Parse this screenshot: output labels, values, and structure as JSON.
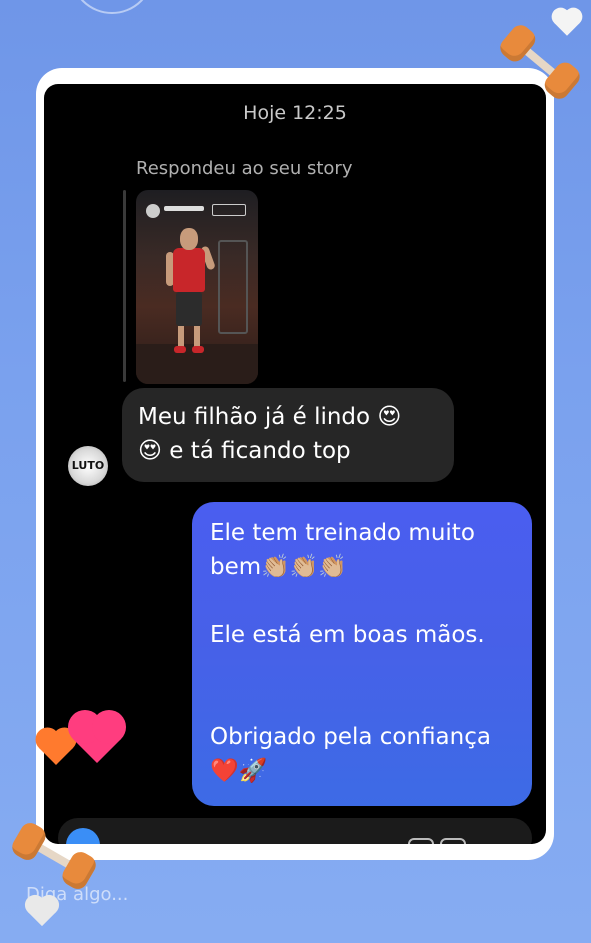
{
  "chat": {
    "timestamp": "Hoje 12:25",
    "reply_label": "Respondeu ao seu story",
    "incoming_line1": "Meu filhão já é  lindo 😍",
    "incoming_line2": "😍 e tá ficando top",
    "outgoing_line1": "Ele tem treinado muito",
    "outgoing_line2": "bem👏🏼👏🏼👏🏼",
    "outgoing_line3": "Ele está em boas mãos.",
    "outgoing_line4": "Obrigado pela confiança",
    "outgoing_line5": "❤️🚀",
    "avatar_text": "LUTO"
  },
  "composer": {
    "placeholder": "Diga algo..."
  },
  "icons": {
    "dumbbell": "dumbbell-icon",
    "heart": "heart-icon",
    "camera": "camera-icon"
  },
  "colors": {
    "outgoing_bubble": "#4760e8",
    "incoming_bubble": "#262626",
    "background": "#7aa1ee"
  }
}
